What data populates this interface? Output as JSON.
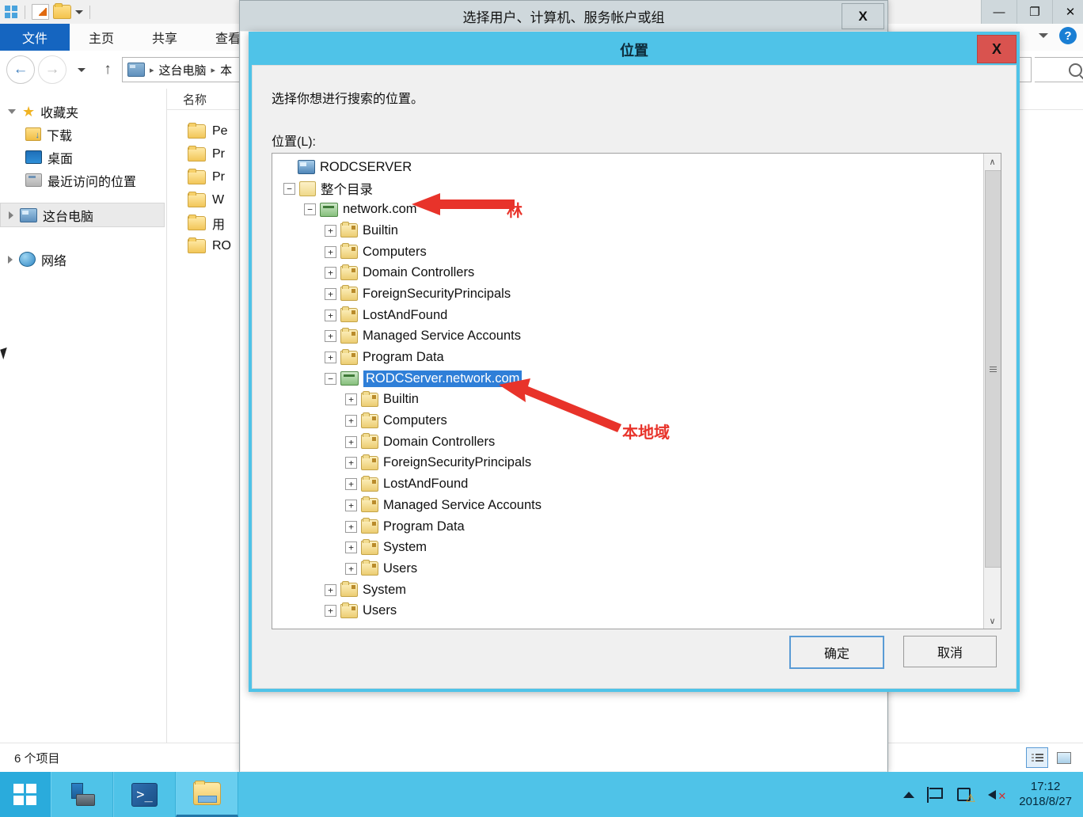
{
  "explorer": {
    "quick_access": [
      "windows-logo-icon",
      "new-folder-icon",
      "folder-icon",
      "chevron-down-icon"
    ],
    "tabs": [
      {
        "label": "文件",
        "active": true
      },
      {
        "label": "主页",
        "active": false
      },
      {
        "label": "共享",
        "active": false
      },
      {
        "label": "查看",
        "active": false
      }
    ],
    "window_controls": {
      "minimize": "—",
      "maximize": "❐",
      "close": "✕"
    },
    "help_label": "?",
    "address": {
      "root_icon": "computer-icon",
      "crumbs": [
        "这台电脑",
        "本"
      ],
      "separator": "▸"
    },
    "search_placeholder": "",
    "nav_items": [
      {
        "label": "收藏夹",
        "icon": "star-icon",
        "expander": "open",
        "selected": false,
        "indent": 0
      },
      {
        "label": "下载",
        "icon": "downloads-folder-icon",
        "expander": "none",
        "selected": false,
        "indent": 1
      },
      {
        "label": "桌面",
        "icon": "desktop-icon",
        "expander": "none",
        "selected": false,
        "indent": 1
      },
      {
        "label": "最近访问的位置",
        "icon": "recent-places-icon",
        "expander": "none",
        "selected": false,
        "indent": 1
      },
      {
        "label": "这台电脑",
        "icon": "computer-icon",
        "expander": "closed",
        "selected": true,
        "indent": 0
      },
      {
        "label": "网络",
        "icon": "network-icon",
        "expander": "closed",
        "selected": false,
        "indent": 0
      }
    ],
    "list_header": "名称",
    "list_items": [
      "Pe",
      "Pr",
      "Pr",
      "W",
      "用",
      "RO"
    ],
    "status": "6 个项目",
    "view_buttons": [
      "details-view-icon",
      "thumbnail-view-icon"
    ]
  },
  "outer_dialog": {
    "title": "选择用户、计算机、服务帐户或组",
    "close_label": "X"
  },
  "location_dialog": {
    "title": "位置",
    "close_label": "X",
    "prompt": "选择你想进行搜索的位置。",
    "field_label": "位置(L):",
    "tree": [
      {
        "label": "RODCSERVER",
        "indent": 0,
        "expander": "none",
        "icon": "server-icon",
        "selected": false
      },
      {
        "label": "整个目录",
        "indent": 0,
        "expander": "minus",
        "icon": "directory-icon",
        "selected": false
      },
      {
        "label": "network.com",
        "indent": 1,
        "expander": "minus",
        "icon": "domain-icon",
        "selected": false
      },
      {
        "label": "Builtin",
        "indent": 2,
        "expander": "plus",
        "icon": "ou-icon",
        "selected": false
      },
      {
        "label": "Computers",
        "indent": 2,
        "expander": "plus",
        "icon": "ou-icon",
        "selected": false
      },
      {
        "label": "Domain Controllers",
        "indent": 2,
        "expander": "plus",
        "icon": "ou-icon",
        "selected": false
      },
      {
        "label": "ForeignSecurityPrincipals",
        "indent": 2,
        "expander": "plus",
        "icon": "ou-icon",
        "selected": false
      },
      {
        "label": "LostAndFound",
        "indent": 2,
        "expander": "plus",
        "icon": "ou-icon",
        "selected": false
      },
      {
        "label": "Managed Service Accounts",
        "indent": 2,
        "expander": "plus",
        "icon": "ou-icon",
        "selected": false
      },
      {
        "label": "Program Data",
        "indent": 2,
        "expander": "plus",
        "icon": "ou-icon",
        "selected": false
      },
      {
        "label": "RODCServer.network.com",
        "indent": 2,
        "expander": "minus",
        "icon": "domain-icon",
        "selected": true
      },
      {
        "label": "Builtin",
        "indent": 3,
        "expander": "plus",
        "icon": "ou-icon",
        "selected": false
      },
      {
        "label": "Computers",
        "indent": 3,
        "expander": "plus",
        "icon": "ou-icon",
        "selected": false
      },
      {
        "label": "Domain Controllers",
        "indent": 3,
        "expander": "plus",
        "icon": "ou-icon",
        "selected": false
      },
      {
        "label": "ForeignSecurityPrincipals",
        "indent": 3,
        "expander": "plus",
        "icon": "ou-icon",
        "selected": false
      },
      {
        "label": "LostAndFound",
        "indent": 3,
        "expander": "plus",
        "icon": "ou-icon",
        "selected": false
      },
      {
        "label": "Managed Service Accounts",
        "indent": 3,
        "expander": "plus",
        "icon": "ou-icon",
        "selected": false
      },
      {
        "label": "Program Data",
        "indent": 3,
        "expander": "plus",
        "icon": "ou-icon",
        "selected": false
      },
      {
        "label": "System",
        "indent": 3,
        "expander": "plus",
        "icon": "ou-icon",
        "selected": false
      },
      {
        "label": "Users",
        "indent": 3,
        "expander": "plus",
        "icon": "ou-icon",
        "selected": false
      },
      {
        "label": "System",
        "indent": 2,
        "expander": "plus",
        "icon": "ou-icon",
        "selected": false
      },
      {
        "label": "Users",
        "indent": 2,
        "expander": "plus",
        "icon": "ou-icon",
        "selected": false
      }
    ],
    "scrollbar": {
      "up": "∧",
      "down": "∨"
    },
    "buttons": {
      "ok": "确定",
      "cancel": "取消"
    }
  },
  "annotations": [
    {
      "text": "林",
      "color": "#e8332a"
    },
    {
      "text": "本地域",
      "color": "#e8332a"
    }
  ],
  "taskbar": {
    "start_icon": "windows-start-icon",
    "items": [
      "server-manager-icon",
      "powershell-icon",
      "file-explorer-icon"
    ],
    "tray": [
      "show-hidden-icons-arrow",
      "flag-action-center-icon",
      "network-warning-icon",
      "volume-muted-icon"
    ],
    "time": "17:12",
    "date": "2018/8/27"
  }
}
